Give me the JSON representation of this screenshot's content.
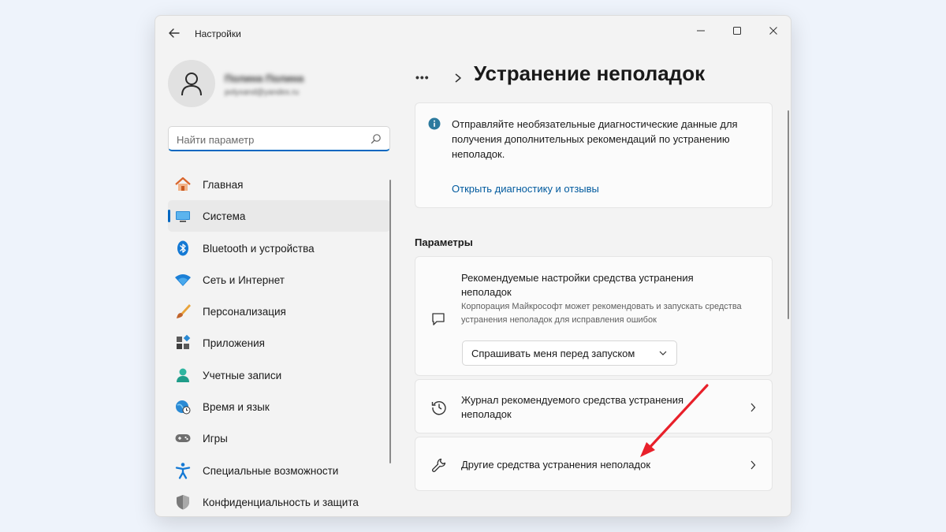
{
  "window": {
    "title": "Настройки"
  },
  "profile": {
    "name": "Полина Полина",
    "email": "polyxand@yandex.ru"
  },
  "search": {
    "placeholder": "Найти параметр",
    "value": ""
  },
  "sidebar": {
    "items": [
      {
        "label": "Главная",
        "icon": "home-icon"
      },
      {
        "label": "Система",
        "icon": "monitor-icon",
        "active": true
      },
      {
        "label": "Bluetooth и устройства",
        "icon": "bluetooth-icon"
      },
      {
        "label": "Сеть и Интернет",
        "icon": "wifi-icon"
      },
      {
        "label": "Персонализация",
        "icon": "brush-icon"
      },
      {
        "label": "Приложения",
        "icon": "apps-icon"
      },
      {
        "label": "Учетные записи",
        "icon": "account-icon"
      },
      {
        "label": "Время и язык",
        "icon": "globe-clock-icon"
      },
      {
        "label": "Игры",
        "icon": "gamepad-icon"
      },
      {
        "label": "Специальные возможности",
        "icon": "accessibility-icon"
      },
      {
        "label": "Конфиденциальность и защита",
        "icon": "shield-icon"
      }
    ]
  },
  "header": {
    "breadcrumb_more": "•••",
    "title": "Устранение неполадок"
  },
  "info_card": {
    "text": "Отправляйте необязательные диагностические данные для получения дополнительных рекомендаций по устранению неполадок.",
    "link": "Открыть диагностику и отзывы"
  },
  "section": {
    "title": "Параметры"
  },
  "recommended": {
    "title": "Рекомендуемые настройки средства устранения неполадок",
    "description": "Корпорация Майкрософт может рекомендовать и запускать средства устранения неполадок для исправления ошибок",
    "dropdown_value": "Спрашивать меня перед запуском"
  },
  "history": {
    "title": "Журнал рекомендуемого средства устранения неполадок"
  },
  "other": {
    "title": "Другие средства устранения неполадок"
  },
  "colors": {
    "accent": "#0067c0",
    "link": "#005a9e",
    "arrow": "#e8202a"
  }
}
